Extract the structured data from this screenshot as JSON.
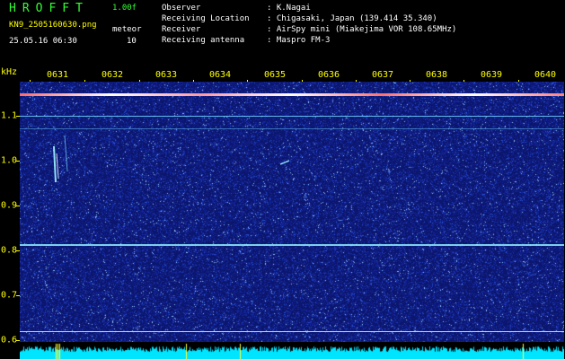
{
  "header": {
    "brand": "HROFFT",
    "version": "1.00f",
    "filename": "KN9_2505160630.png",
    "datetime": "25.05.16 06:30",
    "meteor_label": "meteor",
    "meteor_count": "10"
  },
  "info": {
    "labels": [
      "Observer",
      "Receiving Location",
      "Receiver",
      "Receiving antenna"
    ],
    "values": [
      ": K.Nagai",
      ": Chigasaki, Japan (139.414 35.340)",
      ": AirSpy mini (Miakejima VOR 108.65MHz)",
      ": Maspro FM-3"
    ]
  },
  "axis": {
    "unit": "kHz",
    "x_ticks": [
      "0631",
      "0632",
      "0633",
      "0634",
      "0635",
      "0636",
      "0637",
      "0638",
      "0639",
      "0640"
    ],
    "y_ticks": [
      "1.1",
      "1.0",
      "0.9",
      "0.8",
      "0.7",
      "0.6"
    ]
  },
  "colors": {
    "background": "#000000",
    "plot_bg": "#0a1470",
    "label_yellow": "#ffff00",
    "brand_green": "#33ff33",
    "spectrum_cyan": "#00e5ff"
  }
}
